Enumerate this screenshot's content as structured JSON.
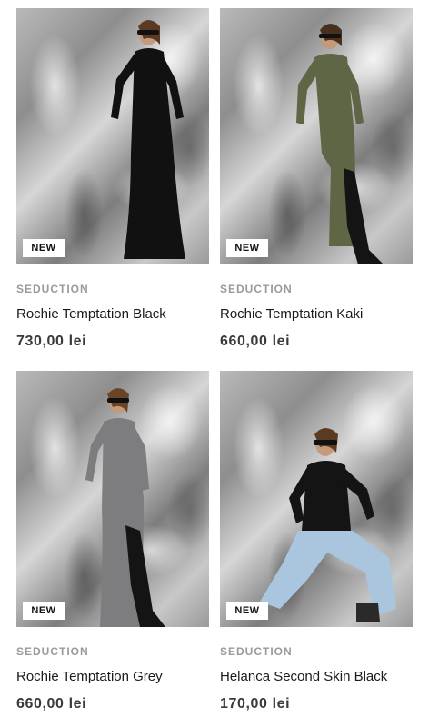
{
  "products": [
    {
      "badge": "NEW",
      "brand": "SEDUCTION",
      "name": "Rochie Temptation Black",
      "price": "730,00 lei",
      "outfit_color": "#111111",
      "photo": "model in long black cut-out maxi dress against silver backdrop"
    },
    {
      "badge": "NEW",
      "brand": "SEDUCTION",
      "name": "Rochie Temptation Kaki",
      "price": "660,00 lei",
      "outfit_color": "#5f6645",
      "photo": "model in khaki cut-out maxi dress with black over-the-knee boots"
    },
    {
      "badge": "NEW",
      "brand": "SEDUCTION",
      "name": "Rochie Temptation Grey",
      "price": "660,00 lei",
      "outfit_color": "#7d7d80",
      "photo": "model in grey cut-out maxi dress with black boots"
    },
    {
      "badge": "NEW",
      "brand": "SEDUCTION",
      "name": "Helanca Second Skin Black",
      "price": "170,00 lei",
      "outfit_color": "#141414",
      "photo": "model seated in black second-skin top and light blue cargo jeans"
    }
  ]
}
